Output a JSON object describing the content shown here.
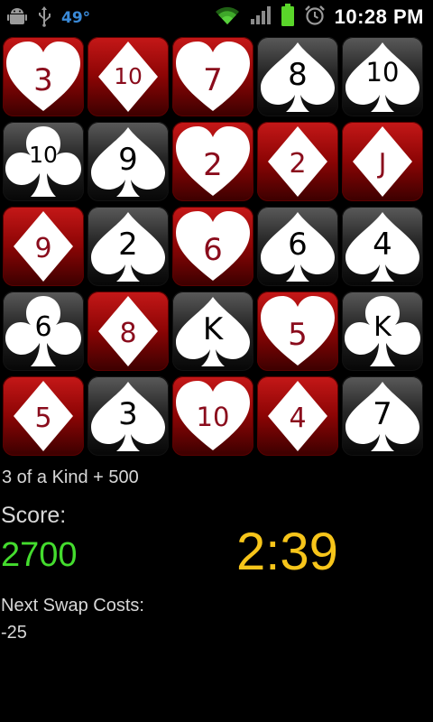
{
  "status_bar": {
    "temperature": "49°",
    "time": "10:28 PM",
    "icons": [
      "android-debug-icon",
      "usb-icon",
      "wifi-icon",
      "signal-icon",
      "battery-icon",
      "alarm-icon"
    ],
    "temp_color": "#3a8ad8"
  },
  "board": {
    "rows": [
      [
        {
          "rank": "3",
          "suit": "heart"
        },
        {
          "rank": "10",
          "suit": "diamond"
        },
        {
          "rank": "7",
          "suit": "heart"
        },
        {
          "rank": "8",
          "suit": "spade"
        },
        {
          "rank": "10",
          "suit": "spade"
        }
      ],
      [
        {
          "rank": "10",
          "suit": "club"
        },
        {
          "rank": "9",
          "suit": "spade"
        },
        {
          "rank": "2",
          "suit": "heart"
        },
        {
          "rank": "2",
          "suit": "diamond"
        },
        {
          "rank": "J",
          "suit": "diamond"
        }
      ],
      [
        {
          "rank": "9",
          "suit": "diamond"
        },
        {
          "rank": "2",
          "suit": "spade"
        },
        {
          "rank": "6",
          "suit": "heart"
        },
        {
          "rank": "6",
          "suit": "spade"
        },
        {
          "rank": "4",
          "suit": "spade"
        }
      ],
      [
        {
          "rank": "6",
          "suit": "club"
        },
        {
          "rank": "8",
          "suit": "diamond"
        },
        {
          "rank": "K",
          "suit": "spade"
        },
        {
          "rank": "5",
          "suit": "heart"
        },
        {
          "rank": "K",
          "suit": "club"
        }
      ],
      [
        {
          "rank": "5",
          "suit": "diamond"
        },
        {
          "rank": "3",
          "suit": "spade"
        },
        {
          "rank": "10",
          "suit": "heart"
        },
        {
          "rank": "4",
          "suit": "diamond"
        },
        {
          "rank": "7",
          "suit": "spade"
        }
      ]
    ]
  },
  "game": {
    "message": "3 of a Kind + 500",
    "score_label": "Score:",
    "score_value": "2700",
    "timer": "2:39",
    "swap_label": "Next Swap Costs:",
    "swap_value": "-25"
  },
  "colors": {
    "score": "#44dd2e",
    "timer": "#f7c51a",
    "red_tile": "#8e0505",
    "black_tile": "#262626"
  }
}
